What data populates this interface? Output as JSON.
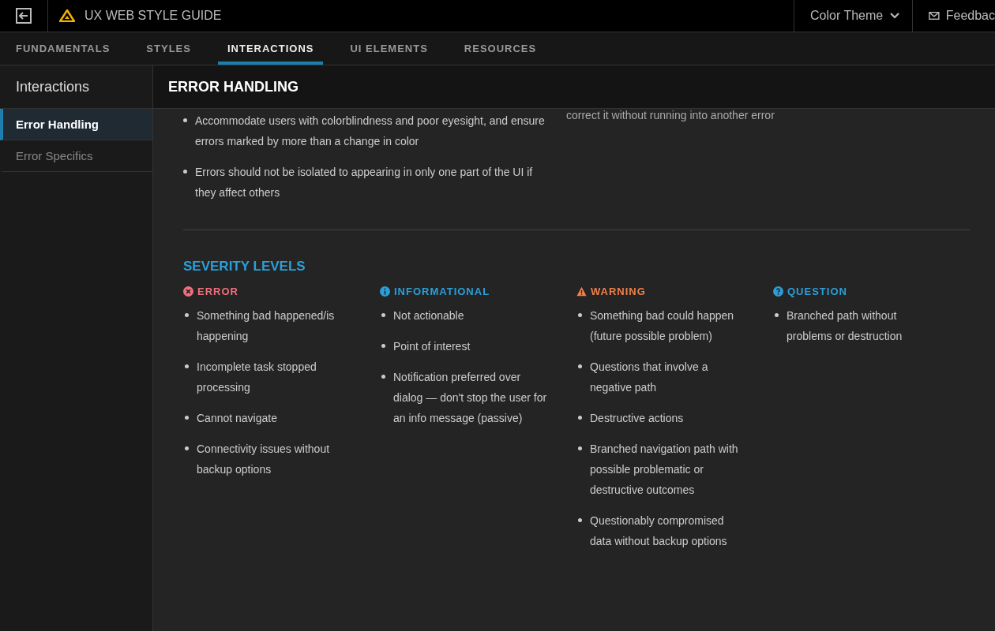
{
  "topbar": {
    "title": "UX WEB STYLE GUIDE",
    "color_theme": "Color Theme",
    "feedback": "Feedbac"
  },
  "tabs": [
    {
      "label": "FUNDAMENTALS",
      "selected": false
    },
    {
      "label": "STYLES",
      "selected": false
    },
    {
      "label": "INTERACTIONS",
      "selected": true
    },
    {
      "label": "UI ELEMENTS",
      "selected": false
    },
    {
      "label": "RESOURCES",
      "selected": false
    }
  ],
  "sidebar": {
    "title": "Interactions",
    "items": [
      {
        "label": "Error Handling",
        "selected": true
      },
      {
        "label": "Error Specifics",
        "selected": false
      }
    ]
  },
  "page_title": "ERROR HANDLING",
  "intro": {
    "left": [
      "Accommodate users with colorblindness and poor eyesight, and ensure errors marked by more than a change in color",
      "Errors should not be isolated to appearing in only one part of the UI if they affect others"
    ],
    "right": "correct it without running into another error"
  },
  "severity": {
    "title": "SEVERITY LEVELS",
    "levels": [
      {
        "kind": "error",
        "label": "ERROR",
        "color": "#f0707c",
        "items": [
          "Something bad happened/is happening",
          "Incomplete task stopped processing",
          "Cannot navigate",
          "Connectivity issues without backup options"
        ]
      },
      {
        "kind": "info",
        "label": "INFORMATIONAL",
        "color": "#2b9fd9",
        "items": [
          "Not actionable",
          "Point of interest",
          "Notification preferred over dialog — don't stop the user for an info message (passive)"
        ]
      },
      {
        "kind": "warning",
        "label": "WARNING",
        "color": "#f0804a",
        "items": [
          "Something bad could happen (future possible problem)",
          "Questions that involve a negative path",
          "Destructive actions",
          "Branched navigation path with possible problematic or destructive outcomes",
          "Questionably compromised data without backup options"
        ]
      },
      {
        "kind": "question",
        "label": "QUESTION",
        "color": "#2b9fd9",
        "items": [
          "Branched path without problems or destruction"
        ]
      }
    ]
  }
}
